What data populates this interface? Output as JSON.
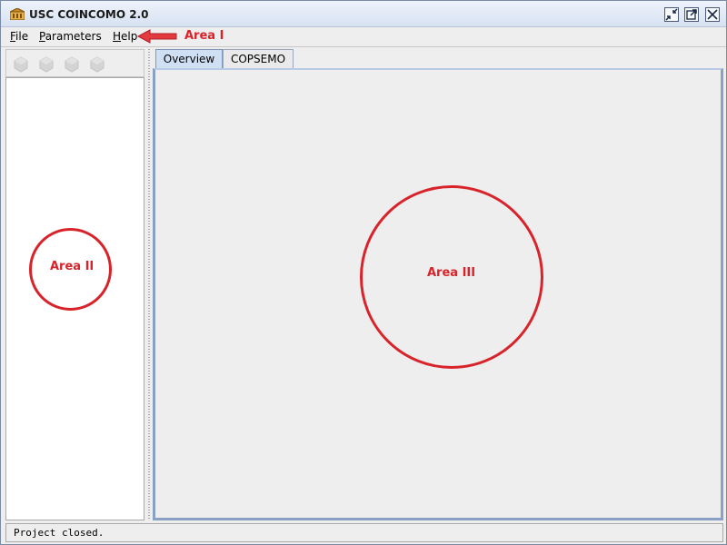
{
  "window": {
    "title": "USC COINCOMO 2.0",
    "controls": {
      "minimize_icon": "restore-down-icon",
      "maximize_icon": "maximize-icon",
      "close_icon": "close-icon"
    }
  },
  "menu": {
    "items": [
      {
        "mnemonic": "F",
        "rest": "ile"
      },
      {
        "mnemonic": "P",
        "rest": "arameters"
      },
      {
        "mnemonic": "H",
        "rest": "elp"
      }
    ]
  },
  "toolbar": {
    "buttons": [
      "gem-icon",
      "gem-icon",
      "gem-icon",
      "gem-icon"
    ],
    "state": "disabled"
  },
  "tabs": [
    {
      "label": "Overview",
      "active": true
    },
    {
      "label": "COPSEMO",
      "active": false
    }
  ],
  "annotations": {
    "area1": "Area I",
    "area2": "Area II",
    "area3": "Area III",
    "color": "#d8232a"
  },
  "status": {
    "text": "Project closed."
  }
}
